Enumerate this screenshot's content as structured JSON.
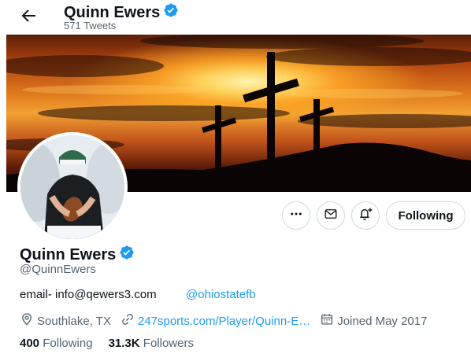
{
  "header": {
    "name": "Quinn Ewers",
    "tweet_count": "571 Tweets"
  },
  "profile": {
    "name": "Quinn Ewers",
    "handle": "@QuinnEwers",
    "bio_text": "email- info@qewers3.com",
    "bio_mention": "@ohiostatefb",
    "location": "Southlake, TX",
    "website": "247sports.com/Player/Quinn-E…",
    "joined": "Joined May 2017",
    "following_count": "400",
    "following_label": "Following",
    "followers_count": "31.3K",
    "followers_label": "Followers"
  },
  "actions": {
    "follow_label": "Following",
    "more_icon": "more-icon",
    "message_icon": "message-icon",
    "notify_icon": "notification-bell-icon"
  },
  "colors": {
    "accent": "#1d9bf0",
    "verified": "#1d9bf0",
    "secondary_text": "#536471"
  }
}
